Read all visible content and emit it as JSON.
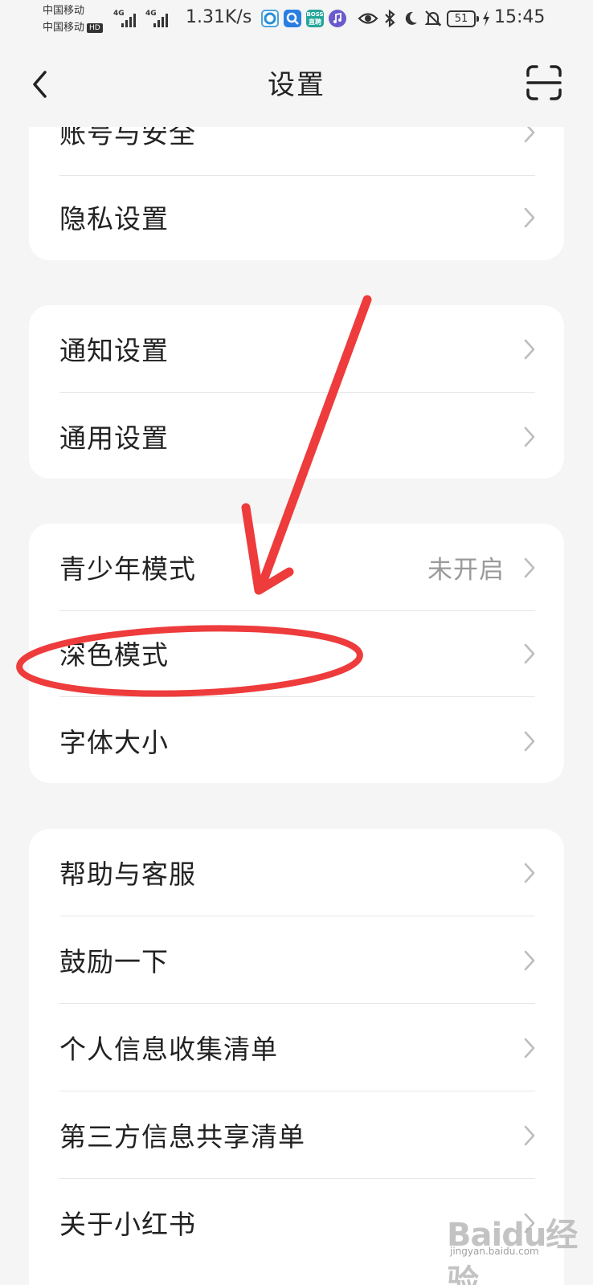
{
  "status_bar": {
    "carrier_1": "中国移动",
    "carrier_2": "中国移动",
    "hd_badge": "HD",
    "network_1": "4G",
    "network_2": "4G",
    "speed": "1.31K/s",
    "boss_app_label_1": "BOSS",
    "boss_app_label_2": "直聘",
    "battery": "51",
    "time": "15:45"
  },
  "nav": {
    "title": "设置",
    "back_icon": "chevron-left-icon",
    "scan_icon": "scan-icon"
  },
  "groups": [
    {
      "items": [
        {
          "label": "账号与安全"
        },
        {
          "label": "隐私设置"
        }
      ]
    },
    {
      "items": [
        {
          "label": "通知设置"
        },
        {
          "label": "通用设置"
        }
      ]
    },
    {
      "items": [
        {
          "label": "青少年模式",
          "value": "未开启"
        },
        {
          "label": "深色模式"
        },
        {
          "label": "字体大小"
        }
      ]
    },
    {
      "items": [
        {
          "label": "帮助与客服"
        },
        {
          "label": "鼓励一下"
        },
        {
          "label": "个人信息收集清单"
        },
        {
          "label": "第三方信息共享清单"
        },
        {
          "label": "关于小红书"
        }
      ]
    }
  ],
  "colors": {
    "background": "#f5f5f5",
    "card": "#ffffff",
    "annotation": "#ee3b3b",
    "secondary_text": "#9a9a9a"
  },
  "watermark": {
    "text": "Baidu经验",
    "sub": "jingyan.baidu.com"
  }
}
